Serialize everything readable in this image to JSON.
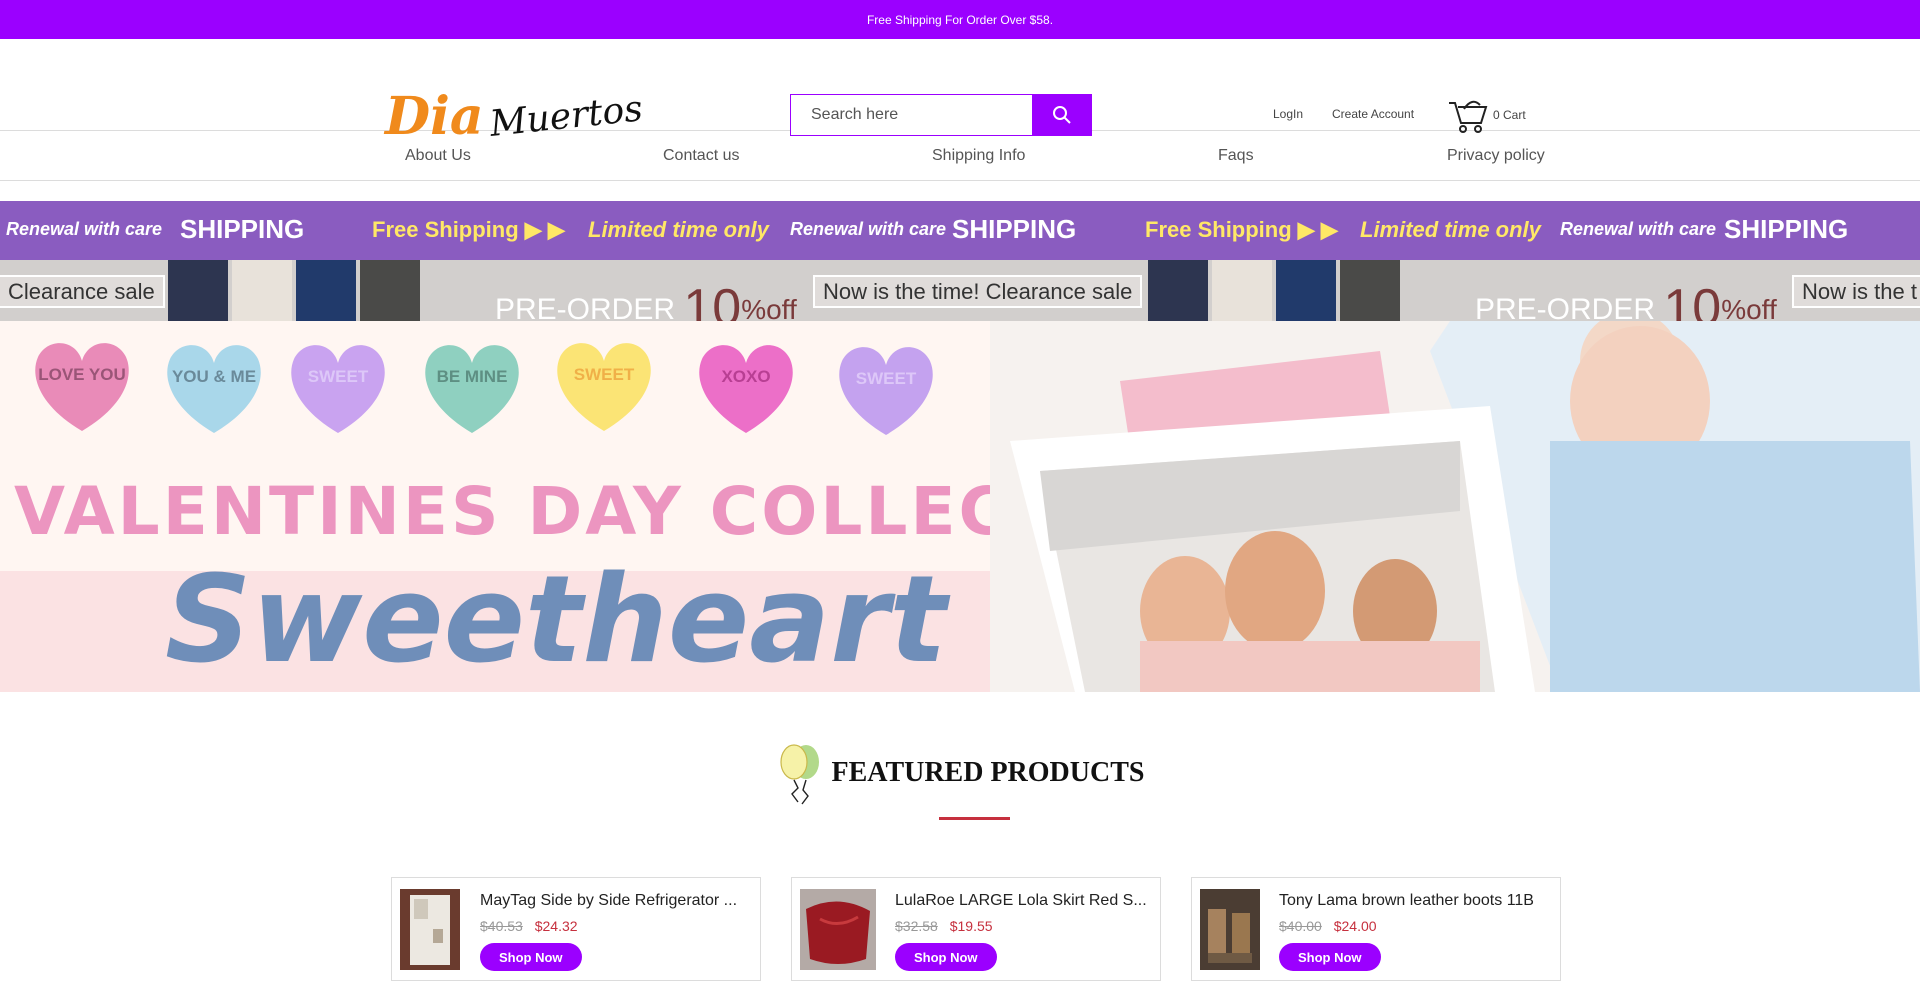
{
  "topbar": {
    "text": "Free Shipping For Order Over $58."
  },
  "header": {
    "logo_main": "Dia",
    "logo_script": "Muertos",
    "search_placeholder": "Search here",
    "login": "LogIn",
    "create_account": "Create Account",
    "cart": "0 Cart"
  },
  "nav": {
    "items": [
      "About Us",
      "Contact us",
      "Shipping Info",
      "Faqs",
      "Privacy policy"
    ]
  },
  "promo1": {
    "renewal": "Renewal with care",
    "shipping": "SHIPPING",
    "free": "Free Shipping ▶ ▶",
    "limited": "Limited time only"
  },
  "promo2": {
    "clearance": "Clearance sale",
    "preorder": "PRE-ORDER",
    "ten": "10",
    "off": "%off",
    "now": "Now is the time! Clearance sale",
    "now_partial": "Now is the t"
  },
  "hero": {
    "hearts": [
      "LOVE YOU",
      "YOU & ME",
      "SWEET",
      "BE MINE",
      "SWEET",
      "XOXO",
      "SWEET"
    ],
    "collection": "VALENTINES DAY COLLECTION",
    "sweetheart": "Sweetheart"
  },
  "featured": {
    "title": "FEATURED PRODUCTS",
    "products": [
      {
        "name": "MayTag Side by Side Refrigerator ...",
        "old_price": "$40.53",
        "price": "$24.32",
        "cta": "Shop Now"
      },
      {
        "name": "LulaRoe LARGE Lola Skirt Red S...",
        "old_price": "$32.58",
        "price": "$19.55",
        "cta": "Shop Now"
      },
      {
        "name": "Tony Lama brown leather boots 11B",
        "old_price": "$40.00",
        "price": "$24.00",
        "cta": "Shop Now"
      }
    ]
  },
  "colors": {
    "brand": "#9b00ff",
    "sale": "#c6303e"
  },
  "icons": {
    "search": "search-icon",
    "cart": "cart-icon",
    "balloon": "balloon-icon"
  }
}
